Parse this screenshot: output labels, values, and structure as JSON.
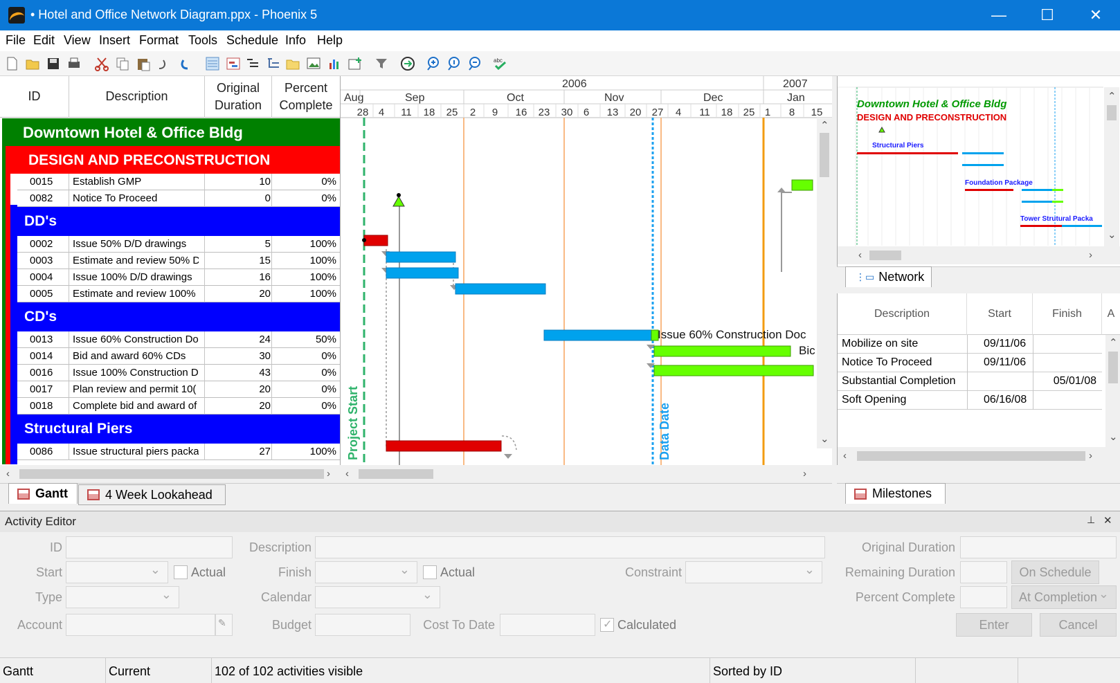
{
  "window": {
    "title": "• Hotel and Office Network Diagram.ppx - Phoenix 5",
    "minimize": "—",
    "maximize": "☐",
    "close": "✕"
  },
  "menu": [
    "File",
    "Edit",
    "View",
    "Insert",
    "Format",
    "Tools",
    "Schedule",
    "Info",
    "Help"
  ],
  "grid": {
    "headers": {
      "id": "ID",
      "description": "Description",
      "orig_line1": "Original",
      "orig_line2": "Duration",
      "pct_line1": "Percent",
      "pct_line2": "Complete"
    },
    "project_band": "Downtown Hotel & Office Bldg",
    "phase_band": "DESIGN AND PRECONSTRUCTION",
    "groups": [
      "DD's",
      "CD's",
      "Structural Piers"
    ],
    "rows": [
      {
        "id": "0015",
        "desc": "Establish GMP",
        "dur": "10",
        "pct": "0%"
      },
      {
        "id": "0082",
        "desc": "Notice To Proceed",
        "dur": "0",
        "pct": "0%"
      },
      {
        "id": "0002",
        "desc": "Issue 50% D/D drawings",
        "dur": "5",
        "pct": "100%"
      },
      {
        "id": "0003",
        "desc": "Estimate and review 50% D",
        "dur": "15",
        "pct": "100%"
      },
      {
        "id": "0004",
        "desc": "Issue 100% D/D drawings",
        "dur": "16",
        "pct": "100%"
      },
      {
        "id": "0005",
        "desc": "Estimate and review 100%",
        "dur": "20",
        "pct": "100%"
      },
      {
        "id": "0013",
        "desc": "Issue 60% Construction Do",
        "dur": "24",
        "pct": "50%"
      },
      {
        "id": "0014",
        "desc": "Bid and award 60% CDs",
        "dur": "30",
        "pct": "0%"
      },
      {
        "id": "0016",
        "desc": "Issue 100% Construction D",
        "dur": "43",
        "pct": "0%"
      },
      {
        "id": "0017",
        "desc": "Plan review and permit 10(",
        "dur": "20",
        "pct": "0%"
      },
      {
        "id": "0018",
        "desc": "Complete bid and award of",
        "dur": "20",
        "pct": "0%"
      },
      {
        "id": "0086",
        "desc": "Issue structural piers packa",
        "dur": "27",
        "pct": "100%"
      }
    ]
  },
  "timescale": {
    "years": [
      "2006",
      "2007"
    ],
    "months": [
      "Aug",
      "Sep",
      "Oct",
      "Nov",
      "Dec",
      "Jan"
    ],
    "days": [
      "28",
      "4",
      "11",
      "18",
      "25",
      "2",
      "9",
      "16",
      "23",
      "30",
      "6",
      "13",
      "20",
      "27",
      "4",
      "11",
      "18",
      "25",
      "1",
      "8",
      "15"
    ],
    "project_start_label": "Project Start",
    "data_date_label": "Data Date",
    "bar_label_1": "Issue 60% Construction Doc",
    "bar_label_2": "Bic"
  },
  "tabs": {
    "gantt": "Gantt",
    "lookahead": "4 Week Lookahead",
    "network": "Network",
    "milestones": "Milestones"
  },
  "network_preview": {
    "title": "Downtown Hotel & Office Bldg",
    "subtitle": "DESIGN AND PRECONSTRUCTION",
    "group1": "Structural Piers",
    "group2": "Foundation Package",
    "group3": "Tower Strutural Packa"
  },
  "milestones": {
    "headers": {
      "description": "Description",
      "start": "Start",
      "finish": "Finish",
      "extra": "A"
    },
    "rows": [
      {
        "desc": "Mobilize on site",
        "start": "09/11/06",
        "finish": ""
      },
      {
        "desc": "Notice To Proceed",
        "start": "09/11/06",
        "finish": ""
      },
      {
        "desc": "Substantial Completion",
        "start": "",
        "finish": "05/01/08"
      },
      {
        "desc": "Soft Opening",
        "start": "06/16/08",
        "finish": ""
      }
    ]
  },
  "editor": {
    "title": "Activity Editor",
    "pin": "⊥",
    "close": "✕",
    "labels": {
      "id": "ID",
      "description": "Description",
      "original_duration": "Original Duration",
      "start": "Start",
      "actual1": "Actual",
      "finish": "Finish",
      "actual2": "Actual",
      "constraint": "Constraint",
      "remaining_duration": "Remaining Duration",
      "type": "Type",
      "calendar": "Calendar",
      "percent_complete": "Percent Complete",
      "account": "Account",
      "budget": "Budget",
      "cost_to_date": "Cost To Date",
      "calculated": "Calculated"
    },
    "buttons": {
      "on_schedule": "On Schedule",
      "at_completion": "At Completion",
      "enter": "Enter",
      "cancel": "Cancel"
    }
  },
  "status": {
    "view": "Gantt",
    "layout": "Current",
    "visible": "102 of 102 activities visible",
    "sort": "Sorted by ID"
  },
  "colors": {
    "titlebar": "#0b78d7",
    "project_band": "#008000",
    "phase_band": "#ff0000",
    "group_band": "#0000ff",
    "bar_red": "#e00000",
    "bar_blue": "#00a2ed",
    "bar_green": "#66ff00",
    "project_start": "#2fb36b",
    "data_date": "#1aa0f0",
    "gridline_orange": "#f7a35c"
  }
}
